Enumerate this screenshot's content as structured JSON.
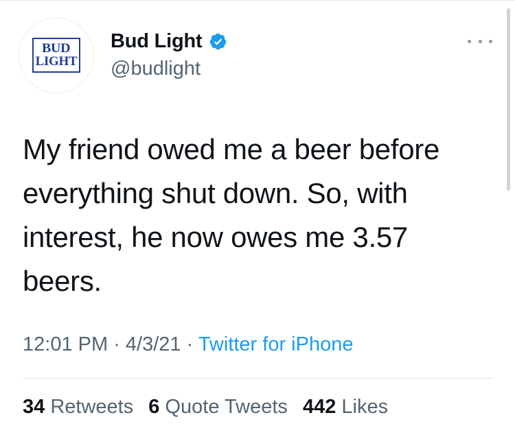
{
  "author": {
    "display_name": "Bud Light",
    "handle": "@budlight",
    "verified": true,
    "logo_line1": "BUD",
    "logo_line2": "LIGHT",
    "logo_color": "#1f3f95",
    "verified_color": "#1d9bf0"
  },
  "more_icon": "more-dots-icon",
  "tweet": {
    "text": "My friend owed me a beer before everything shut down. So, with interest, he now owes me 3.57 beers."
  },
  "meta": {
    "time": "12:01 PM",
    "separator": " · ",
    "date": "4/3/21",
    "source": "Twitter for iPhone"
  },
  "stats": {
    "retweets_count": "34",
    "retweets_label": "Retweets",
    "quotes_count": "6",
    "quotes_label": "Quote Tweets",
    "likes_count": "442",
    "likes_label": "Likes"
  }
}
